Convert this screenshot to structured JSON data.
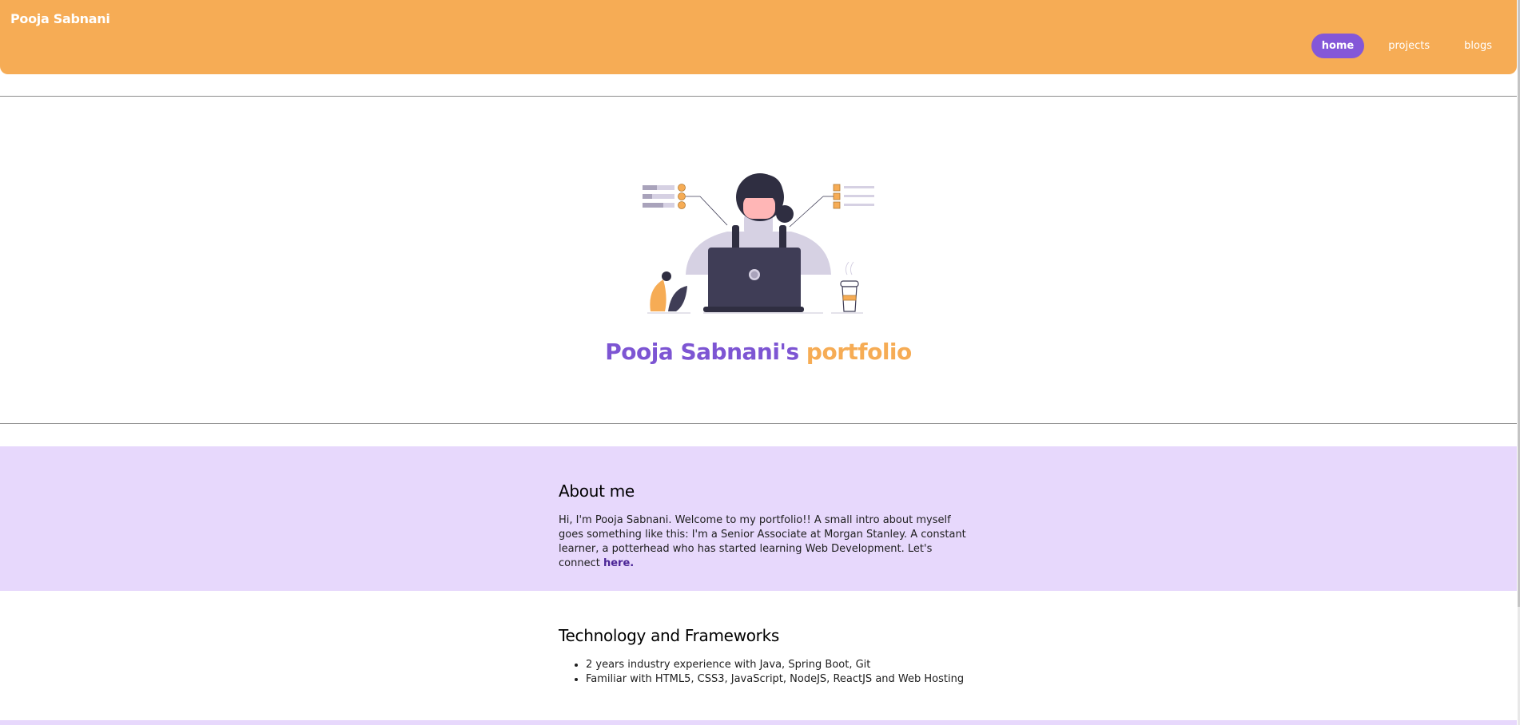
{
  "nav": {
    "brand": "Pooja Sabnani",
    "links": [
      {
        "label": "home",
        "active": true
      },
      {
        "label": "projects",
        "active": false
      },
      {
        "label": "blogs",
        "active": false
      }
    ]
  },
  "hero": {
    "title_name": "Pooja Sabnani's",
    "title_accent": "portfolio"
  },
  "about": {
    "heading": "About me",
    "text": "Hi, I'm Pooja Sabnani. Welcome to my portfolio!! A small intro about myself goes something like this: I'm a Senior Associate at Morgan Stanley. A constant learner, a potterhead who has started learning Web Development. Let's connect ",
    "link_label": "here."
  },
  "tech": {
    "heading": "Technology and Frameworks",
    "items": [
      "2 years industry experience with Java, Spring Boot, Git",
      "Familiar with HTML5, CSS3, JavaScript, NodeJS, ReactJS and Web Hosting"
    ]
  },
  "colors": {
    "nav_bg": "#f6ac55",
    "accent_purple": "#8457d8",
    "about_bg": "#e7d8fc",
    "title_purple": "#7d55d3",
    "title_orange": "#f6ac55"
  }
}
